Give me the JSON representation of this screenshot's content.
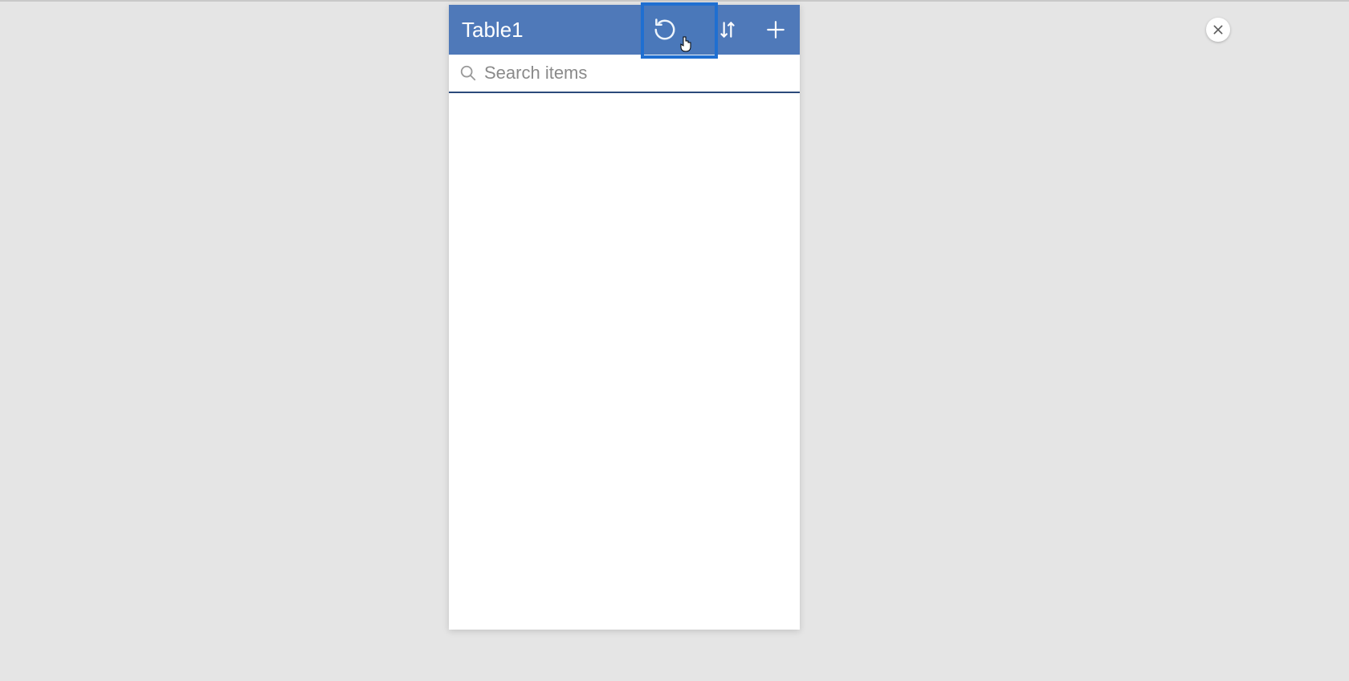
{
  "panel": {
    "title": "Table1",
    "actions": {
      "refresh": "refresh",
      "sort": "sort",
      "add": "add"
    },
    "search": {
      "placeholder": "Search items",
      "value": ""
    }
  },
  "close": {
    "label": "close"
  },
  "colors": {
    "header_bg": "#4f79b9",
    "highlight_border": "#1f6fd1",
    "page_bg": "#e5e5e5",
    "search_underline": "#2b4a7a"
  }
}
